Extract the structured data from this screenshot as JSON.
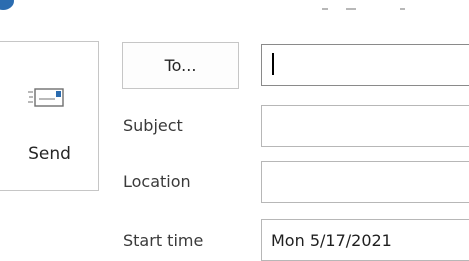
{
  "toolbar": {
    "send_label": "Send"
  },
  "recipients": {
    "to_label": "To...",
    "to_value": ""
  },
  "fields": {
    "subject_label": "Subject",
    "subject_value": "",
    "location_label": "Location",
    "location_value": "",
    "start_time_label": "Start time",
    "start_time_value": "Mon 5/17/2021"
  },
  "icons": {
    "app": "outlook-app-icon",
    "send": "envelope-send-icon"
  },
  "colors": {
    "accent": "#2b6cb0",
    "border": "#c6c6c6",
    "text": "#262626"
  }
}
